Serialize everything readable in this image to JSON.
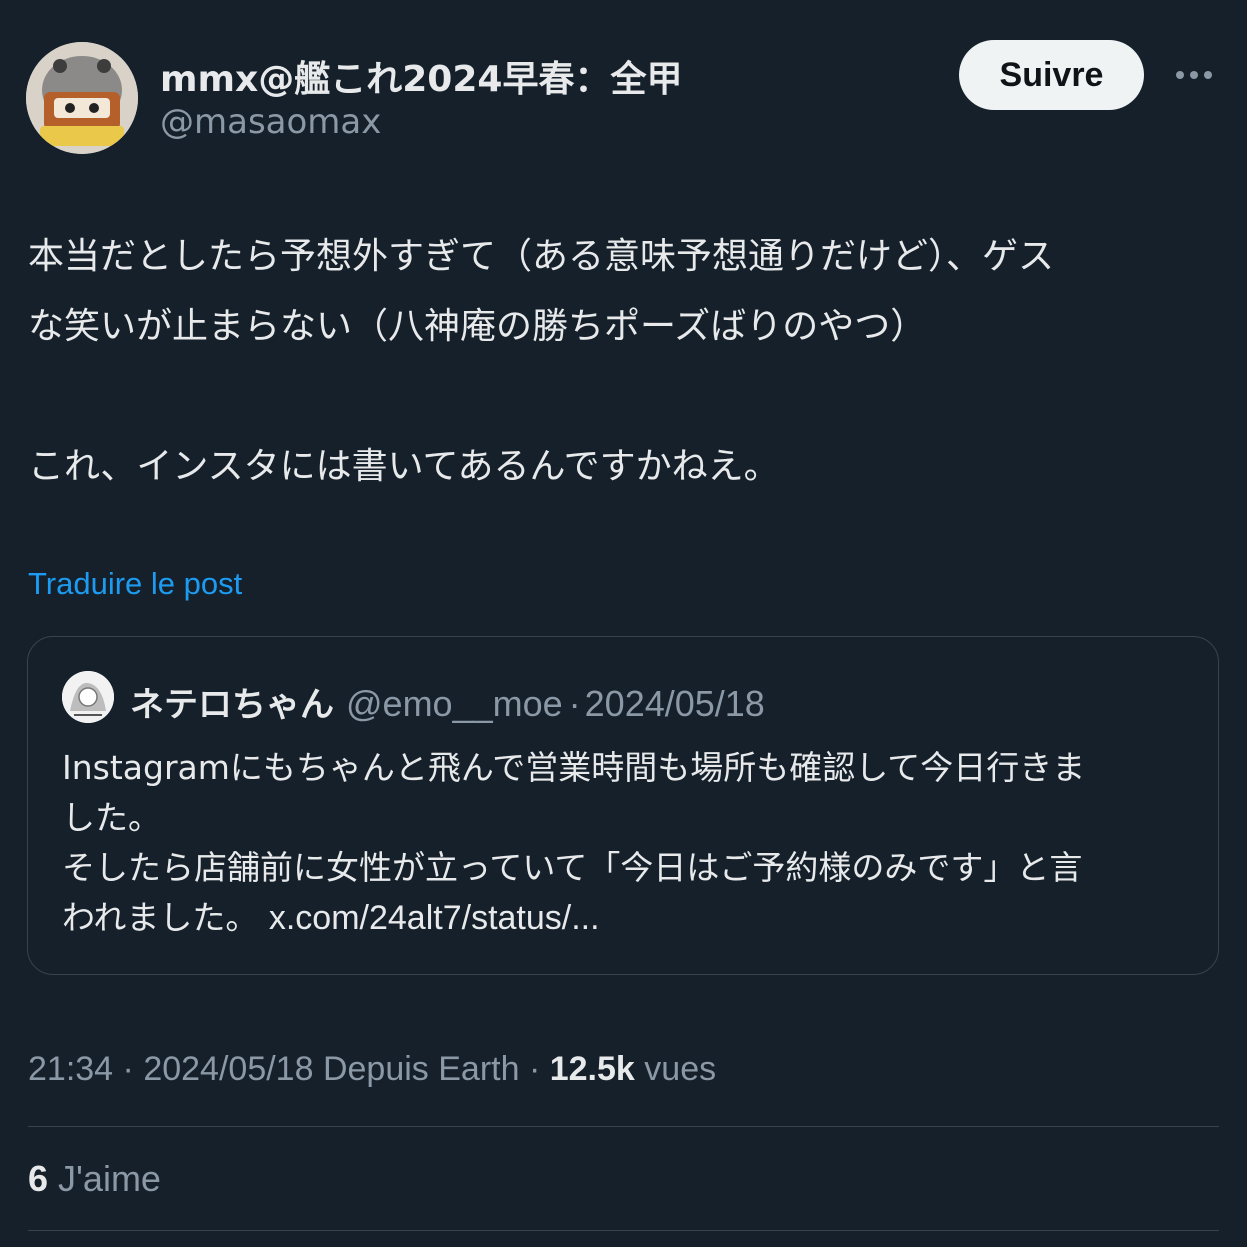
{
  "author": {
    "display_name": "mmx@艦これ2024早春：全甲",
    "handle": "@masaomax"
  },
  "follow_label": "Suivre",
  "post": {
    "lines": [
      "本当だとしたら予想外すぎて（ある意味予想通りだけど）、ゲス",
      "な笑いが止まらない（八神庵の勝ちポーズばりのやつ）",
      "これ、インスタには書いてあるんですかねえ。"
    ]
  },
  "translate_label": "Traduire le post",
  "quoted": {
    "name": "ネテロちゃん",
    "handle": "@emo__moe",
    "date": "2024/05/18",
    "lines": [
      "Instagramにもちゃんと飛んで営業時間も場所も確認して今日行きま",
      "した。",
      "そしたら店舗前に女性が立っていて「今日はご予約様のみです」と言",
      "われました。"
    ],
    "link": "x.com/24alt7/status/..."
  },
  "meta": {
    "time": "21:34",
    "date": "2024/05/18",
    "source": "Depuis Earth",
    "views_count": "12.5k",
    "views_label": "vues"
  },
  "likes": {
    "count": "6",
    "label": "J'aime"
  },
  "icons": {
    "more": "more-horizontal-icon",
    "avatar": "user-avatar",
    "quoted_avatar": "quoted-user-avatar"
  }
}
